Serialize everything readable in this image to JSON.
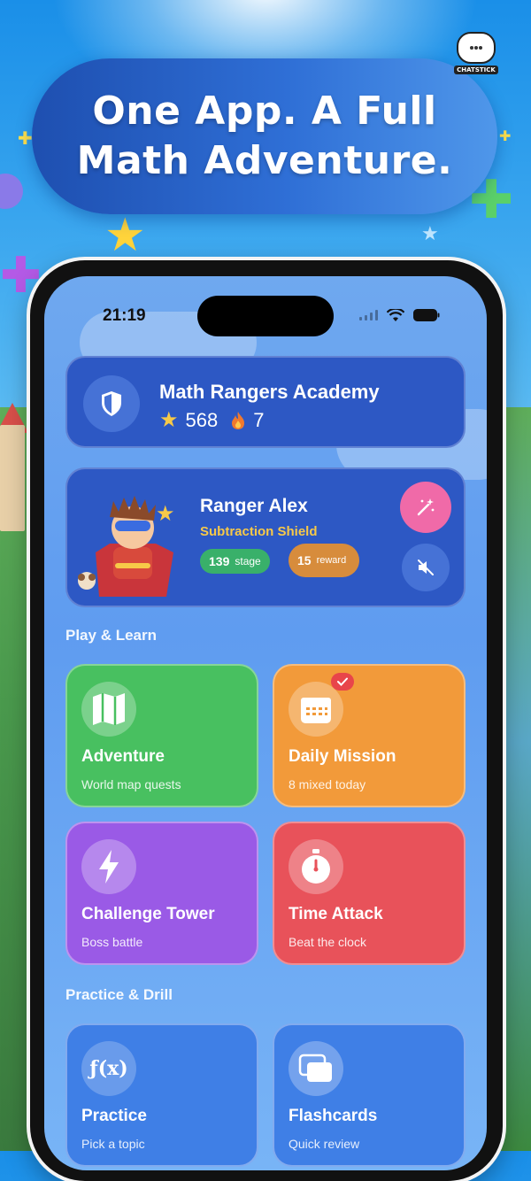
{
  "headline": {
    "line1": "One App. A Full",
    "line2": "Math Adventure."
  },
  "brand": {
    "name": "CHATSTICK"
  },
  "status_bar": {
    "time": "21:19"
  },
  "academy": {
    "name": "Math Rangers Academy",
    "stars": "568",
    "streak": "7",
    "icon": "shield-icon"
  },
  "ranger": {
    "name": "Ranger Alex",
    "subtitle": "Subtraction Shield",
    "stage_count": "139",
    "stage_label": "stage",
    "reward_count": "15",
    "reward_label": "reward"
  },
  "sections": {
    "play": "Play & Learn",
    "practice": "Practice & Drill"
  },
  "tiles": [
    {
      "title": "Adventure",
      "subtitle": "World map quests",
      "icon": "map-icon",
      "color": "#48c060"
    },
    {
      "title": "Daily Mission",
      "subtitle": "8 mixed today",
      "icon": "calendar-icon",
      "color": "#f29a3a"
    },
    {
      "title": "Challenge Tower",
      "subtitle": "Boss battle",
      "icon": "lightning-icon",
      "color": "#9a5ae6"
    },
    {
      "title": "Time Attack",
      "subtitle": "Beat the clock",
      "icon": "stopwatch-icon",
      "color": "#e8525a"
    },
    {
      "title": "Practice",
      "subtitle": "Pick a topic",
      "icon": "function-icon",
      "function_label": "ƒ(x)",
      "color": "#3f7fe6"
    },
    {
      "title": "Flashcards",
      "subtitle": "Quick review",
      "icon": "cards-icon",
      "color": "#3f7fe6"
    }
  ],
  "colors": {
    "card_blue": "#2d58c4",
    "accent_yellow": "#f7c948",
    "stage_green": "#39b06a",
    "reward_orange": "#d78c3c",
    "magic_pink": "#f06aa8"
  }
}
